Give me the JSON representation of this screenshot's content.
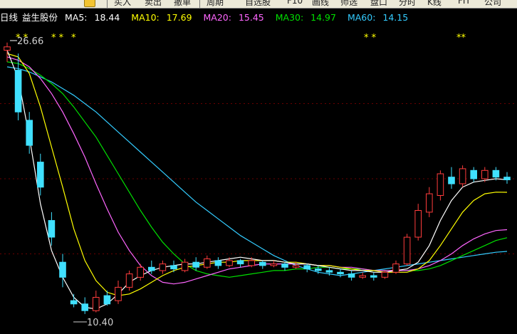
{
  "toolbar": {
    "items": [
      "买入",
      "卖出",
      "撤单",
      "周期",
      "自选股",
      "F10",
      "画线",
      "师选",
      "盘口",
      "分时",
      "K线",
      "FIT",
      "公司"
    ]
  },
  "legend": {
    "period": "日线",
    "stock_name": "益生股份",
    "ma5": {
      "label": "MA5:",
      "value": "18.44",
      "color": "#ffffff"
    },
    "ma10": {
      "label": "MA10:",
      "value": "17.69",
      "color": "#ffff00"
    },
    "ma20": {
      "label": "MA20:",
      "value": "15.45",
      "color": "#ff66ff"
    },
    "ma30": {
      "label": "MA30:",
      "value": "14.97",
      "color": "#00e000"
    },
    "ma60": {
      "label": "MA60:",
      "value": "14.15",
      "color": "#33ccff"
    }
  },
  "annotations": {
    "high_label": "26.66",
    "low_label": "10.40",
    "star_marks": [
      "* *",
      "* *",
      "*",
      "* *",
      "**"
    ]
  },
  "chart_data": {
    "type": "candlestick",
    "ylim": [
      9.5,
      27.5
    ],
    "grid": true,
    "up_color": "#ff3c3c",
    "down_color": "#40e0ff",
    "high": 26.66,
    "low": 10.4,
    "ma5": [
      26.2,
      24.5,
      21.0,
      17.0,
      14.2,
      12.6,
      11.4,
      10.8,
      10.7,
      11.0,
      11.6,
      12.3,
      12.7,
      13.0,
      13.2,
      13.3,
      13.4,
      13.4,
      13.5,
      13.6,
      13.7,
      13.8,
      13.7,
      13.6,
      13.6,
      13.5,
      13.4,
      13.4,
      13.3,
      13.2,
      13.1,
      13.0,
      13.0,
      12.9,
      12.9,
      13.0,
      13.1,
      13.5,
      14.5,
      16.0,
      17.2,
      18.0,
      18.3,
      18.4,
      18.5,
      18.44
    ],
    "ma10": [
      26.0,
      25.8,
      24.8,
      22.8,
      20.4,
      18.0,
      15.5,
      13.6,
      12.4,
      11.7,
      11.5,
      11.6,
      11.9,
      12.3,
      12.7,
      13.0,
      13.2,
      13.3,
      13.4,
      13.5,
      13.5,
      13.6,
      13.6,
      13.6,
      13.6,
      13.5,
      13.5,
      13.4,
      13.3,
      13.3,
      13.2,
      13.1,
      13.0,
      13.0,
      12.9,
      12.9,
      12.9,
      13.1,
      13.6,
      14.5,
      15.5,
      16.5,
      17.2,
      17.6,
      17.7,
      17.69
    ],
    "ma20": [
      25.8,
      25.6,
      25.2,
      24.5,
      23.6,
      22.5,
      21.2,
      19.8,
      18.2,
      16.7,
      15.3,
      14.2,
      13.3,
      12.7,
      12.3,
      12.2,
      12.3,
      12.5,
      12.7,
      12.9,
      13.1,
      13.2,
      13.3,
      13.4,
      13.4,
      13.4,
      13.4,
      13.4,
      13.3,
      13.3,
      13.2,
      13.2,
      13.1,
      13.0,
      13.0,
      13.0,
      13.0,
      13.1,
      13.3,
      13.6,
      14.0,
      14.5,
      14.9,
      15.2,
      15.4,
      15.45
    ],
    "ma30": [
      25.5,
      25.4,
      25.1,
      24.7,
      24.2,
      23.6,
      22.8,
      21.9,
      21.0,
      19.9,
      18.8,
      17.7,
      16.6,
      15.6,
      14.7,
      14.0,
      13.4,
      13.0,
      12.8,
      12.7,
      12.6,
      12.7,
      12.8,
      12.9,
      13.0,
      13.0,
      13.1,
      13.1,
      13.2,
      13.2,
      13.1,
      13.1,
      13.1,
      13.0,
      13.0,
      13.0,
      13.0,
      13.0,
      13.1,
      13.3,
      13.6,
      13.9,
      14.2,
      14.5,
      14.8,
      14.97
    ],
    "ma60": [
      25.2,
      25.1,
      24.9,
      24.6,
      24.3,
      23.9,
      23.5,
      23.0,
      22.5,
      21.9,
      21.3,
      20.7,
      20.1,
      19.5,
      18.9,
      18.3,
      17.7,
      17.1,
      16.6,
      16.1,
      15.6,
      15.1,
      14.7,
      14.3,
      13.9,
      13.6,
      13.3,
      13.1,
      12.9,
      12.8,
      12.7,
      12.8,
      12.9,
      13.0,
      13.1,
      13.2,
      13.3,
      13.4,
      13.5,
      13.6,
      13.7,
      13.8,
      13.9,
      14.0,
      14.1,
      14.15
    ],
    "candles": [
      [
        26.2,
        26.4,
        25.5,
        26.66
      ],
      [
        25.0,
        22.5,
        22.0,
        26.0
      ],
      [
        22.0,
        20.5,
        20.0,
        22.5
      ],
      [
        19.5,
        18.0,
        17.5,
        20.0
      ],
      [
        16.0,
        15.0,
        14.5,
        16.5
      ],
      [
        13.5,
        12.6,
        12.0,
        14.0
      ],
      [
        11.2,
        11.0,
        10.8,
        11.6
      ],
      [
        11.0,
        10.6,
        10.4,
        11.4
      ],
      [
        10.6,
        11.4,
        10.5,
        11.8
      ],
      [
        11.5,
        11.0,
        10.9,
        11.8
      ],
      [
        11.2,
        12.0,
        11.0,
        12.4
      ],
      [
        12.0,
        12.8,
        11.8,
        13.0
      ],
      [
        12.6,
        13.2,
        12.4,
        13.4
      ],
      [
        13.2,
        13.0,
        12.8,
        13.6
      ],
      [
        13.0,
        13.4,
        12.8,
        13.6
      ],
      [
        13.3,
        13.1,
        12.9,
        13.6
      ],
      [
        13.0,
        13.5,
        12.9,
        13.7
      ],
      [
        13.5,
        13.2,
        13.0,
        13.8
      ],
      [
        13.2,
        13.7,
        13.1,
        13.9
      ],
      [
        13.6,
        13.3,
        13.1,
        13.8
      ],
      [
        13.3,
        13.6,
        13.2,
        13.8
      ],
      [
        13.6,
        13.4,
        13.2,
        13.7
      ],
      [
        13.3,
        13.6,
        13.2,
        13.8
      ],
      [
        13.5,
        13.3,
        13.1,
        13.6
      ],
      [
        13.3,
        13.4,
        13.2,
        13.6
      ],
      [
        13.4,
        13.2,
        13.0,
        13.5
      ],
      [
        13.2,
        13.3,
        13.1,
        13.5
      ],
      [
        13.3,
        13.1,
        12.9,
        13.4
      ],
      [
        13.1,
        13.0,
        12.8,
        13.3
      ],
      [
        13.0,
        12.9,
        12.7,
        13.2
      ],
      [
        12.9,
        12.8,
        12.6,
        13.1
      ],
      [
        12.8,
        12.6,
        12.4,
        13.0
      ],
      [
        12.6,
        12.7,
        12.5,
        12.9
      ],
      [
        12.7,
        12.6,
        12.4,
        12.9
      ],
      [
        12.6,
        12.9,
        12.5,
        13.0
      ],
      [
        12.9,
        13.4,
        12.8,
        13.6
      ],
      [
        13.4,
        15.0,
        13.3,
        15.2
      ],
      [
        15.0,
        16.6,
        14.8,
        17.0
      ],
      [
        16.5,
        17.6,
        16.2,
        18.0
      ],
      [
        17.5,
        18.8,
        17.2,
        19.0
      ],
      [
        18.6,
        18.2,
        17.9,
        19.2
      ],
      [
        18.2,
        19.1,
        18.0,
        19.3
      ],
      [
        19.0,
        18.5,
        18.3,
        19.2
      ],
      [
        18.5,
        19.0,
        18.3,
        19.2
      ],
      [
        19.0,
        18.6,
        18.4,
        19.2
      ],
      [
        18.6,
        18.44,
        18.2,
        18.9
      ]
    ]
  }
}
